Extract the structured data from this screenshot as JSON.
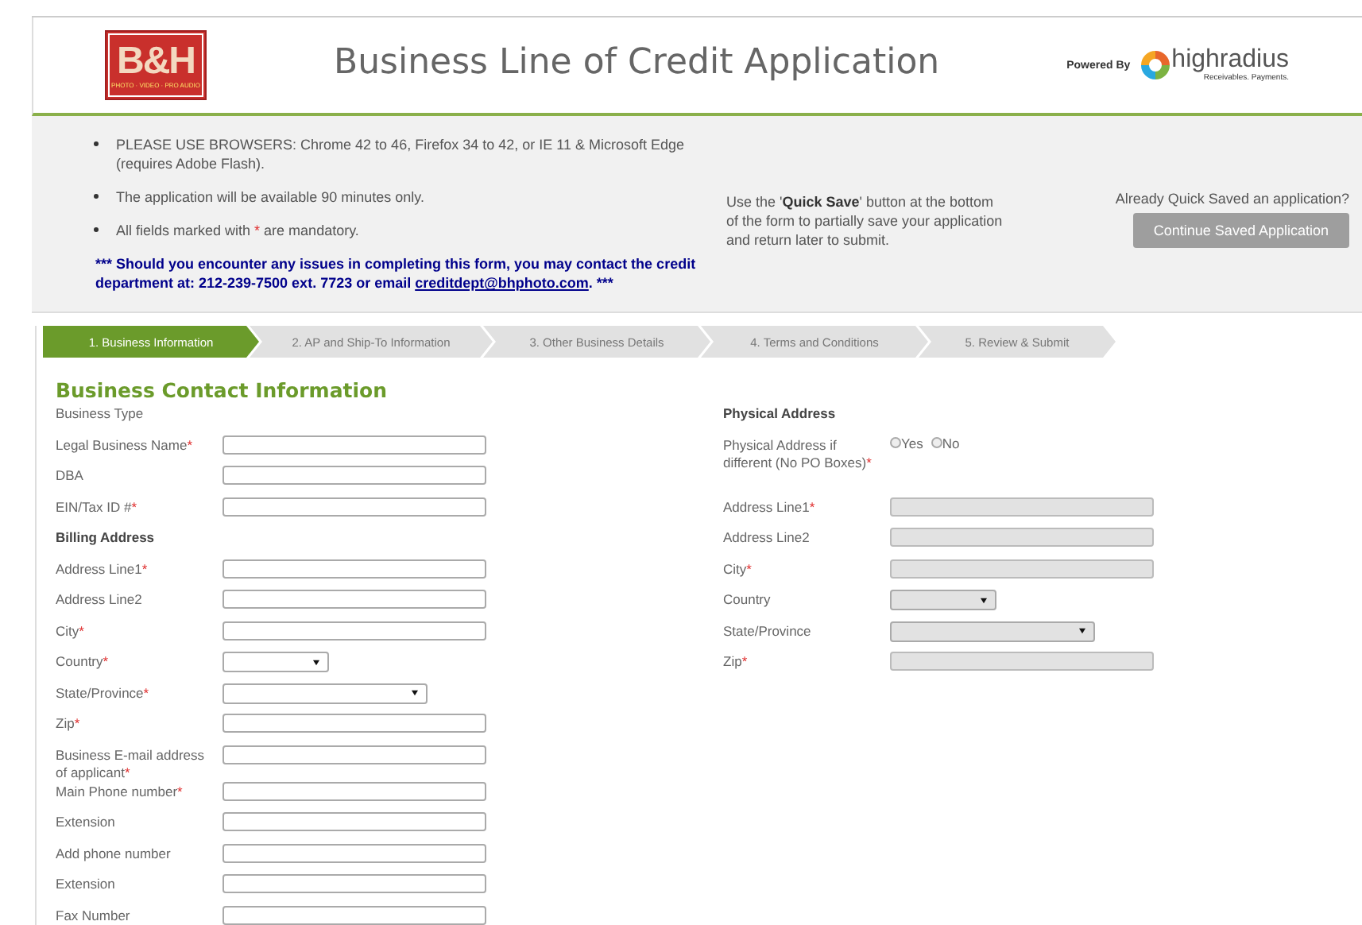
{
  "header": {
    "logo": {
      "mark": "B&H",
      "tagline": "PHOTO · VIDEO · PRO AUDIO"
    },
    "title": "Business Line of Credit Application",
    "powered_by": "Powered By",
    "partner": {
      "name": "highradius",
      "tagline": "Receivables. Payments."
    }
  },
  "notices": {
    "bullets": [
      {
        "kind": "plain",
        "text": "PLEASE USE BROWSERS: Chrome 42 to 46, Firefox 34 to 42, or IE 11 & Microsoft Edge (requires Adobe Flash)."
      },
      {
        "kind": "plain",
        "text": "The application will be available 90 minutes only."
      },
      {
        "kind": "mark",
        "before": "All fields marked with ",
        "mark": "*",
        "after": " are mandatory."
      }
    ],
    "contact": {
      "before": "*** Should you encounter any issues in completing this form, you may contact the credit department at: 212-239-7500 ext. 7723 or email ",
      "link": "creditdept@bhphoto.com",
      "after": ". ***"
    },
    "quick_save": "Use the '**Quick Save**' button at the bottom of the form to partially save your application and return later to submit.",
    "resume_prompt": "Already Quick Saved an application?",
    "resume_button": "Continue Saved Application"
  },
  "steps": [
    {
      "label": "1. Business Information",
      "selected": true
    },
    {
      "label": "2. AP and Ship-To Information",
      "selected": false
    },
    {
      "label": "3. Other Business Details",
      "selected": false
    },
    {
      "label": "4. Terms and Conditions",
      "selected": false
    },
    {
      "label": "5. Review & Submit",
      "selected": false
    }
  ],
  "section_title": "Business Contact Information",
  "left_fields": [
    {
      "kind": "label",
      "label": "Business Type"
    },
    {
      "kind": "text",
      "label": "Legal Business Name",
      "mark": "*",
      "disabled": false
    },
    {
      "kind": "text",
      "label": "DBA",
      "disabled": false
    },
    {
      "kind": "text",
      "label": "EIN/Tax ID #",
      "mark": "*",
      "disabled": false
    },
    {
      "kind": "heading",
      "label": "Billing Address"
    },
    {
      "kind": "text",
      "label": "Address Line1",
      "mark": "*",
      "disabled": false
    },
    {
      "kind": "text",
      "label": "Address Line2",
      "disabled": false
    },
    {
      "kind": "text",
      "label": "City",
      "mark": "*",
      "disabled": false
    },
    {
      "kind": "select_short",
      "label": "Country",
      "mark": "*",
      "disabled": false
    },
    {
      "kind": "select_long",
      "label": "State/Province",
      "mark": "*",
      "disabled": false
    },
    {
      "kind": "text",
      "label": "Zip",
      "mark": "*",
      "disabled": false
    },
    {
      "kind": "text",
      "label": "Business E-mail address of applicant",
      "mark": "*",
      "disabled": false
    },
    {
      "kind": "text",
      "label": "Main Phone number",
      "mark": "*",
      "disabled": false
    },
    {
      "kind": "text",
      "label": "Extension",
      "disabled": false
    },
    {
      "kind": "text",
      "label": "Add phone number",
      "disabled": false
    },
    {
      "kind": "text",
      "label": "Extension",
      "disabled": false
    },
    {
      "kind": "text",
      "label": "Fax Number",
      "disabled": false
    }
  ],
  "right_fields": [
    {
      "kind": "heading",
      "label": "Physical Address"
    },
    {
      "kind": "radio",
      "label": "Physical Address if different (No PO Boxes)",
      "mark": "*",
      "options": [
        {
          "label": "Yes",
          "selected": false
        },
        {
          "label": "No",
          "selected": false
        }
      ]
    },
    {
      "kind": "text",
      "label": "Address Line1",
      "mark": "*",
      "disabled": true
    },
    {
      "kind": "text",
      "label": "Address Line2",
      "disabled": true
    },
    {
      "kind": "text",
      "label": "City",
      "mark": "*",
      "disabled": true
    },
    {
      "kind": "select_short",
      "label": "Country",
      "disabled": true
    },
    {
      "kind": "select_long",
      "label": "State/Province",
      "disabled": true
    },
    {
      "kind": "text",
      "label": "Zip",
      "mark": "*",
      "disabled": true
    }
  ]
}
